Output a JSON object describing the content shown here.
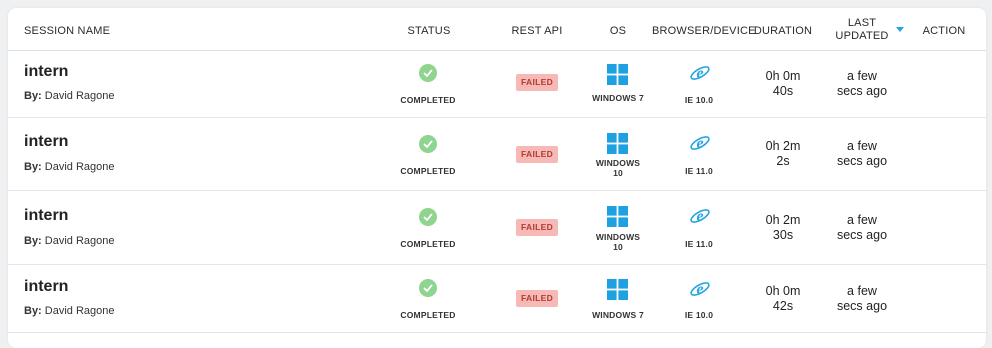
{
  "header": {
    "session_name": "SESSION NAME",
    "status": "STATUS",
    "rest_api": "REST API",
    "os": "OS",
    "browser_device": "BROWSER/DEVICE",
    "duration": "DURATION",
    "last_updated_line1": "LAST",
    "last_updated_line2": "UPDATED",
    "action": "ACTION",
    "sort_icon": "caret-down-icon",
    "accent_color": "#2aa3e6"
  },
  "sessions": [
    {
      "name": "intern",
      "by_label": "By:",
      "by_user": "David Ragone",
      "status": "COMPLETED",
      "rest_api": "FAILED",
      "os_line1": "WINDOWS 7",
      "os_line2": "",
      "browser": "IE 10.0",
      "duration_line1": "0h 0m",
      "duration_line2": "40s",
      "updated_line1": "a few",
      "updated_line2": "secs ago"
    },
    {
      "name": "intern",
      "by_label": "By:",
      "by_user": "David Ragone",
      "status": "COMPLETED",
      "rest_api": "FAILED",
      "os_line1": "WINDOWS",
      "os_line2": "10",
      "browser": "IE 11.0",
      "duration_line1": "0h 2m",
      "duration_line2": "2s",
      "updated_line1": "a few",
      "updated_line2": "secs ago"
    },
    {
      "name": "intern",
      "by_label": "By:",
      "by_user": "David Ragone",
      "status": "COMPLETED",
      "rest_api": "FAILED",
      "os_line1": "WINDOWS",
      "os_line2": "10",
      "browser": "IE 11.0",
      "duration_line1": "0h 2m",
      "duration_line2": "30s",
      "updated_line1": "a few",
      "updated_line2": "secs ago"
    },
    {
      "name": "intern",
      "by_label": "By:",
      "by_user": "David Ragone",
      "status": "COMPLETED",
      "rest_api": "FAILED",
      "os_line1": "WINDOWS 7",
      "os_line2": "",
      "browser": "IE 10.0",
      "duration_line1": "0h 0m",
      "duration_line2": "42s",
      "updated_line1": "a few",
      "updated_line2": "secs ago"
    }
  ],
  "colors": {
    "completed": "#8fd48f",
    "failed_bg": "#f6b9b6",
    "failed_text": "#b43a34",
    "windows_blue": "#1ea1e0",
    "ie_blue": "#27a4e3"
  }
}
